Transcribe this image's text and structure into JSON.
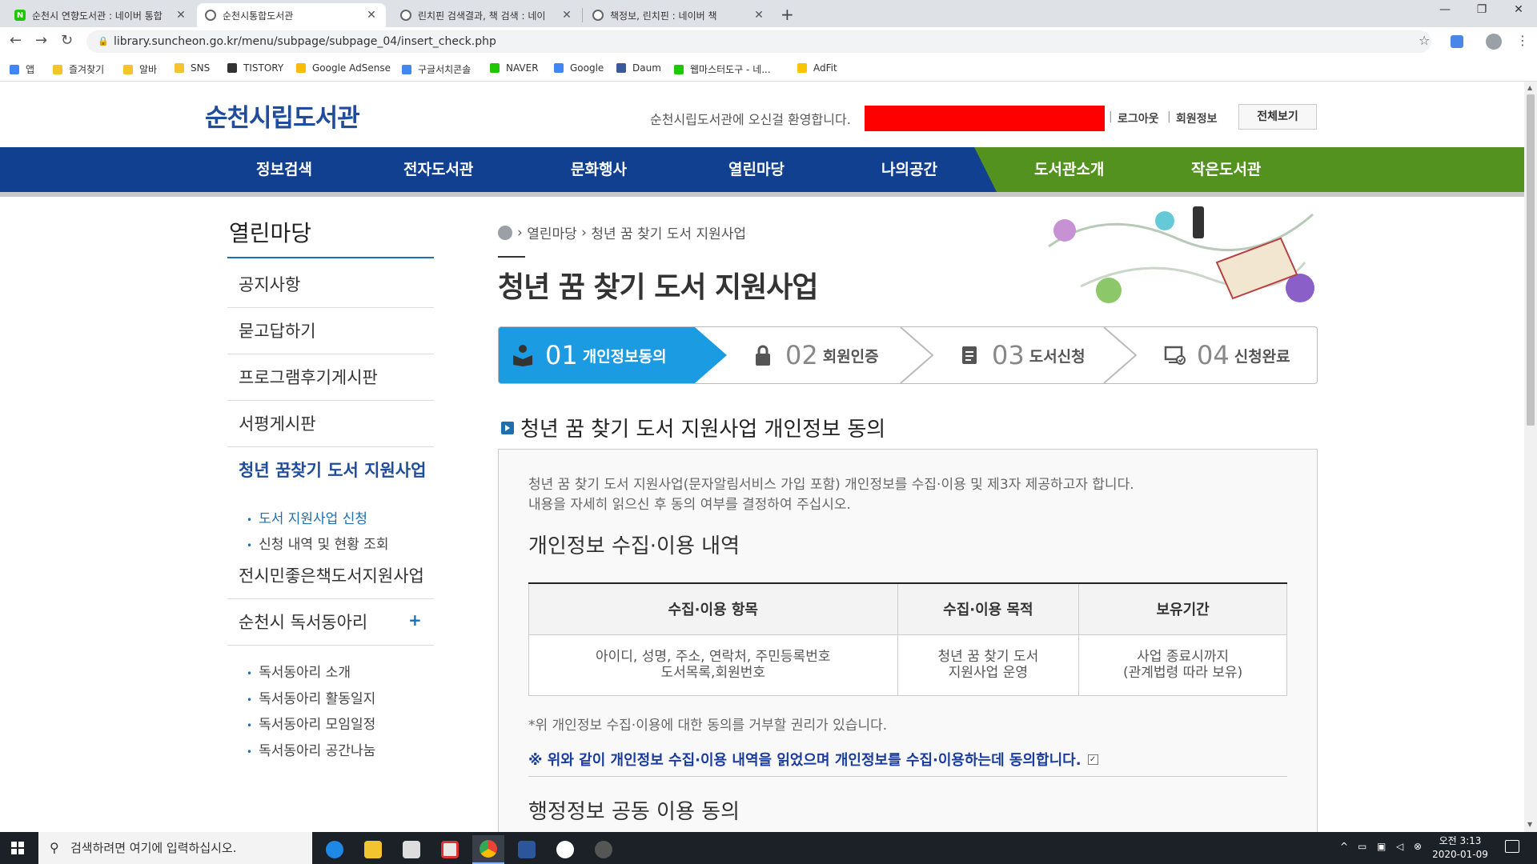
{
  "browser": {
    "tabs": [
      {
        "title": "순천시 연향도서관 : 네이버 통합",
        "icon_color": "#1ec800",
        "icon_text": "N"
      },
      {
        "title": "순천시통합도서관",
        "icon_color": "#777777",
        "icon_text": ""
      },
      {
        "title": "린치핀 검색결과, 책 검색 : 네이",
        "icon_color": "#777777",
        "icon_text": ""
      },
      {
        "title": "책정보, 린치핀 : 네이버 책",
        "icon_color": "#777777",
        "icon_text": ""
      }
    ],
    "active_tab": 1,
    "url": "library.suncheon.go.kr/menu/subpage/subpage_04/insert_check.php",
    "bookmarks": [
      {
        "label": "앱",
        "color": "#4285f4"
      },
      {
        "label": "즐겨찾기",
        "color": "#f4c430"
      },
      {
        "label": "알바",
        "color": "#f4c430"
      },
      {
        "label": "SNS",
        "color": "#f4c430"
      },
      {
        "label": "TISTORY",
        "color": "#333333"
      },
      {
        "label": "Google AdSense",
        "color": "#fbbc05"
      },
      {
        "label": "구글서치콘솔",
        "color": "#4285f4"
      },
      {
        "label": "NAVER",
        "color": "#1ec800"
      },
      {
        "label": "Google",
        "color": "#4285f4"
      },
      {
        "label": "Daum",
        "color": "#3b5998"
      },
      {
        "label": "웹마스터도구 - 네...",
        "color": "#1ec800"
      },
      {
        "label": "AdFit",
        "color": "#f7c600"
      }
    ]
  },
  "site": {
    "logo": "순천시립도서관",
    "welcome": "순천시립도서관에 오신걸 환영합니다.",
    "logout": "로그아웃",
    "member_info": "회원정보",
    "view_all": "전체보기",
    "gnb": [
      "정보검색",
      "전자도서관",
      "문화행사",
      "열린마당",
      "나의공간",
      "도서관소개",
      "작은도서관"
    ]
  },
  "lnb": {
    "title": "열린마당",
    "items": [
      "공지사항",
      "묻고답하기",
      "프로그램후기게시판",
      "서평게시판",
      "청년 꿈찾기 도서 지원사업"
    ],
    "sub_active": [
      "도서 지원사업 신청",
      "신청 내역 및 현황 조회"
    ],
    "items2": [
      "전시민좋은책도서지원사업",
      "순천시 독서동아리"
    ],
    "plus": "+",
    "club_subs": [
      "독서동아리 소개",
      "독서동아리 활동일지",
      "독서동아리 모임일정",
      "독서동아리 공간나눔"
    ]
  },
  "content": {
    "breadcrumb": [
      "열린마당",
      "청년 꿈 찾기 도서 지원사업"
    ],
    "title": "청년 꿈 찾기 도서 지원사업",
    "steps": [
      {
        "num": "01",
        "label": "개인정보동의",
        "icon": "book-reader-icon"
      },
      {
        "num": "02",
        "label": "회원인증",
        "icon": "lock-icon"
      },
      {
        "num": "03",
        "label": "도서신청",
        "icon": "document-icon"
      },
      {
        "num": "04",
        "label": "신청완료",
        "icon": "monitor-check-icon"
      }
    ],
    "section_title": "청년 꿈 찾기 도서 지원사업 개인정보 동의",
    "intro_line1": "청년 꿈 찾기 도서 지원사업(문자알림서비스 가입 포함) 개인정보를 수집·이용 및 제3자 제공하고자 합니다.",
    "intro_line2": "내용을 자세히 읽으신 후 동의 여부를 결정하여 주십시오.",
    "sub_heading1": "개인정보 수집·이용 내역",
    "table_headers": [
      "수집·이용 항목",
      "수집·이용 목적",
      "보유기간"
    ],
    "table_row": {
      "item_line1": "아이디, 성명, 주소, 연락처, 주민등록번호",
      "item_line2": "도서목록,회원번호",
      "purpose_line1": "청년 꿈 찾기 도서",
      "purpose_line2": "지원사업 운영",
      "period_line1": "사업 종료시까지",
      "period_line2": "(관계법령 따라 보유)"
    },
    "note": "*위 개인정보 수집·이용에 대한 동의를 거부할 권리가 있습니다.",
    "agree_text": "※ 위와 같이 개인정보 수집·이용 내역을 읽었으며 개인정보를 수집·이용하는데 동의합니다.",
    "agree_checked": "✓",
    "sub_heading2": "행정정보 공동 이용 동의"
  },
  "taskbar": {
    "search_placeholder": "검색하려면 여기에 입력하십시오.",
    "time": "오전 3:13",
    "date": "2020-01-09"
  }
}
